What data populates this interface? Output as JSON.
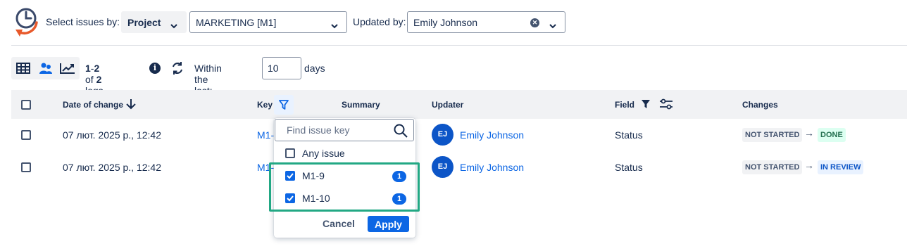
{
  "header": {
    "select_issues_label": "Select issues by:",
    "select_by_value": "Project",
    "project_value": "MARKETING [M1]",
    "updated_by_label": "Updated by:",
    "updated_by_value": "Emily Johnson"
  },
  "toolbar": {
    "range_start": "1",
    "range_end": "2",
    "of_label": "of",
    "total": "2",
    "logs_label": "logs",
    "within_label": "Within the last:",
    "days_value": "10",
    "days_label": "days"
  },
  "table": {
    "columns": {
      "date": "Date of change",
      "key": "Key",
      "summary": "Summary",
      "updater": "Updater",
      "field": "Field",
      "changes": "Changes"
    },
    "rows": [
      {
        "date": "07 лют. 2025 р., 12:42",
        "key": "M1-",
        "updater_initials": "EJ",
        "updater": "Emily Johnson",
        "field": "Status",
        "from": "NOT STARTED",
        "to": "DONE"
      },
      {
        "date": "07 лют. 2025 р., 12:42",
        "key": "M1-",
        "updater_initials": "EJ",
        "updater": "Emily Johnson",
        "field": "Status",
        "from": "NOT STARTED",
        "to": "IN REVIEW"
      }
    ]
  },
  "key_filter_popup": {
    "search_placeholder": "Find issue key",
    "options": [
      {
        "label": "Any issue",
        "checked": false,
        "count": ""
      },
      {
        "label": "M1-9",
        "checked": true,
        "count": "1"
      },
      {
        "label": "M1-10",
        "checked": true,
        "count": "1"
      }
    ],
    "cancel_label": "Cancel",
    "apply_label": "Apply"
  },
  "colors": {
    "accent": "#0c66e4",
    "highlight": "#22a884",
    "logo_orange": "#e8592b",
    "logo_navy": "#3b4a6b"
  }
}
